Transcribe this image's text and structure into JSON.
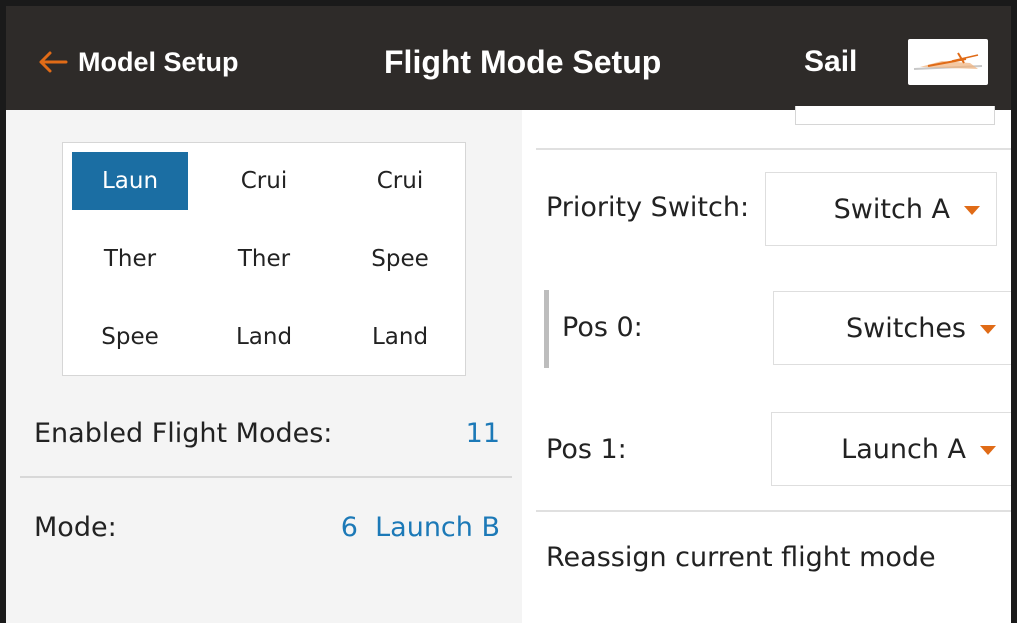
{
  "header": {
    "back_label": "Model Setup",
    "title": "Flight Mode Setup",
    "model_name": "Sail",
    "back_icon": "left-arrow-icon",
    "model_thumbnail_icon": "glider-thumbnail-icon"
  },
  "modes_grid": {
    "cells": [
      "Laun",
      "Crui",
      "Crui",
      "Ther",
      "Ther",
      "Spee",
      "Spee",
      "Land",
      "Land"
    ],
    "selected_index": 0
  },
  "summary": {
    "enabled_label": "Enabled Flight Modes:",
    "enabled_value": "11",
    "mode_label": "Mode:",
    "mode_value": "6  Launch B"
  },
  "settings": {
    "priority_label": "Priority Switch:",
    "priority_value": "Switch A",
    "pos0_label": "Pos 0:",
    "pos0_value": "Switches",
    "pos1_label": "Pos 1:",
    "pos1_value": "Launch A",
    "reassign_label": "Reassign current flight mode"
  },
  "colors": {
    "header_bg": "#2e2b29",
    "accent_orange": "#e06b17",
    "selected_blue": "#1b6ea3",
    "value_blue": "#1c79b7"
  }
}
